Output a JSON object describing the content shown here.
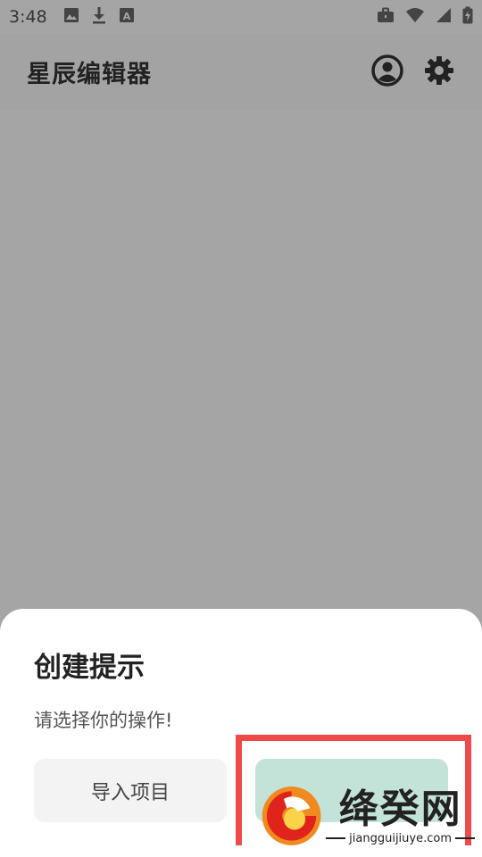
{
  "status_bar": {
    "time": "3:48",
    "left_icons": [
      "image-icon",
      "download-icon",
      "font-icon"
    ],
    "right_icons": [
      "briefcase-icon",
      "wifi-icon",
      "signal-icon",
      "battery-icon"
    ]
  },
  "app_bar": {
    "title": "星辰编辑器",
    "actions": [
      "account-icon",
      "settings-icon"
    ]
  },
  "dialog": {
    "title": "创建提示",
    "message": "请选择你的操作!",
    "import_label": "导入项目",
    "create_label": ""
  },
  "watermark": {
    "cn": "绛癸网",
    "en": "jiangguijiuye.com"
  },
  "colors": {
    "scrim": "#a5a5a5",
    "sheet": "#ffffff",
    "create_button": "#c3e3d8",
    "import_button": "#f3f3f3",
    "highlight": "#ef4a4a"
  }
}
